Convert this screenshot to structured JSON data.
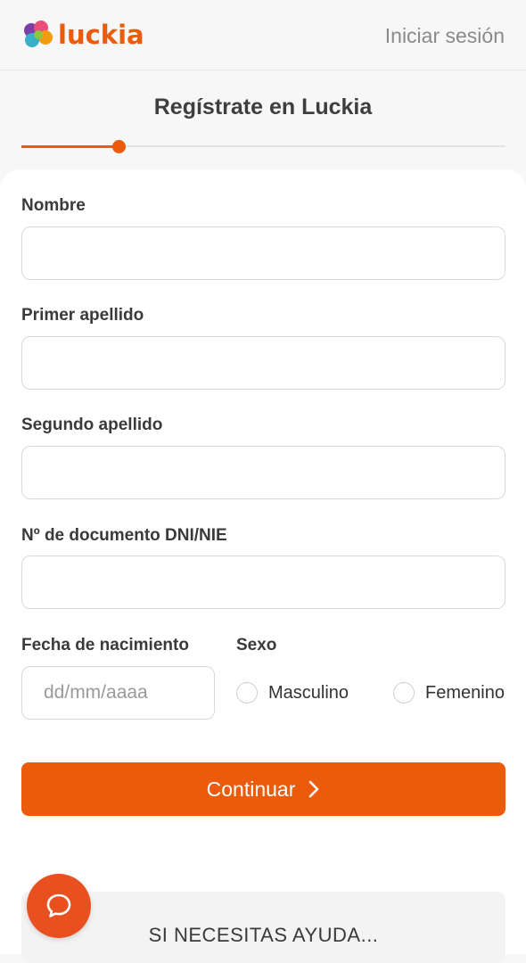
{
  "brand": {
    "name": "luckia",
    "accent_color": "#ea5b0c",
    "logo_icon": "clover-logo-icon"
  },
  "header": {
    "login_label": "Iniciar sesión"
  },
  "page": {
    "title": "Regístrate en Luckia",
    "progress": 0.2
  },
  "form": {
    "nombre": {
      "label": "Nombre",
      "value": ""
    },
    "primer_apellido": {
      "label": "Primer apellido",
      "value": ""
    },
    "segundo_apellido": {
      "label": "Segundo apellido",
      "value": ""
    },
    "documento": {
      "label": "Nº de documento DNI/NIE",
      "value": ""
    },
    "fecha": {
      "label": "Fecha de nacimiento",
      "placeholder": "dd/mm/aaaa",
      "value": ""
    },
    "sexo": {
      "label": "Sexo",
      "options": [
        "Masculino",
        "Femenino"
      ]
    },
    "continue_label": "Continuar",
    "continue_icon": "chevron-right-icon"
  },
  "help": {
    "text": "SI NECESITAS AYUDA...",
    "chat_icon": "chat-bubble-icon"
  }
}
